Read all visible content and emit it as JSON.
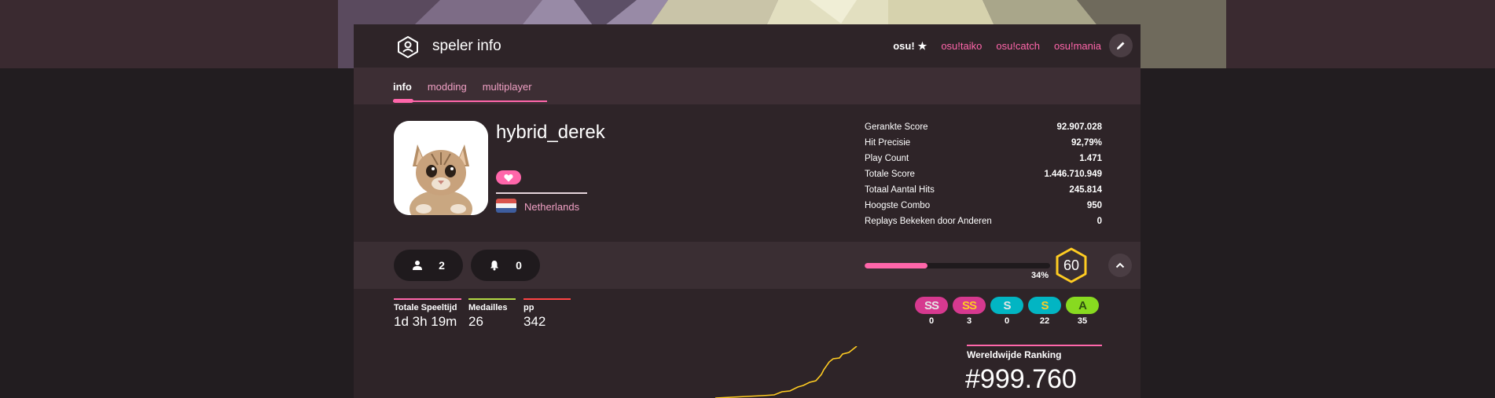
{
  "header": {
    "page_title": "speler info",
    "modes": [
      {
        "label": "osu!",
        "active": true
      },
      {
        "label": "osu!taiko",
        "active": false
      },
      {
        "label": "osu!catch",
        "active": false
      },
      {
        "label": "osu!mania",
        "active": false
      }
    ]
  },
  "tabs": [
    {
      "label": "info",
      "active": true
    },
    {
      "label": "modding",
      "active": false
    },
    {
      "label": "multiplayer",
      "active": false
    }
  ],
  "profile": {
    "username": "hybrid_derek",
    "country": "Netherlands"
  },
  "stats": [
    {
      "label": "Gerankte Score",
      "value": "92.907.028"
    },
    {
      "label": "Hit Precisie",
      "value": "92,79%"
    },
    {
      "label": "Play Count",
      "value": "1.471"
    },
    {
      "label": "Totale Score",
      "value": "1.446.710.949"
    },
    {
      "label": "Totaal Aantal Hits",
      "value": "245.814"
    },
    {
      "label": "Hoogste Combo",
      "value": "950"
    },
    {
      "label": "Replays Bekeken door Anderen",
      "value": "0"
    }
  ],
  "social": {
    "followers": "2",
    "notifications": "0"
  },
  "level": {
    "progress_percent": 34,
    "progress_label": "34%",
    "number": "60"
  },
  "metrics": [
    {
      "label": "Totale Speeltijd",
      "value": "1d 3h 19m",
      "color": "#ff66aa"
    },
    {
      "label": "Medailles",
      "value": "26",
      "color": "#b3d944"
    },
    {
      "label": "pp",
      "value": "342",
      "color": "#ff4444"
    }
  ],
  "grades": [
    {
      "label": "SS",
      "count": "0",
      "color": "#d6398f",
      "text": "#e6e6e6"
    },
    {
      "label": "SS",
      "count": "3",
      "color": "#d6398f",
      "text": "#ffcc22"
    },
    {
      "label": "S",
      "count": "0",
      "color": "#02b5c3",
      "text": "#e6e6e6"
    },
    {
      "label": "S",
      "count": "22",
      "color": "#02b5c3",
      "text": "#ffcc22"
    },
    {
      "label": "A",
      "count": "35",
      "color": "#88da20",
      "text": "#2e4f10"
    }
  ],
  "ranking": {
    "title": "Wereldwijde Ranking",
    "value": "#999.760"
  },
  "colors": {
    "accent": "#ff66aa",
    "level_ring": "#ffcc22",
    "rank_line": "#ffcc22"
  }
}
